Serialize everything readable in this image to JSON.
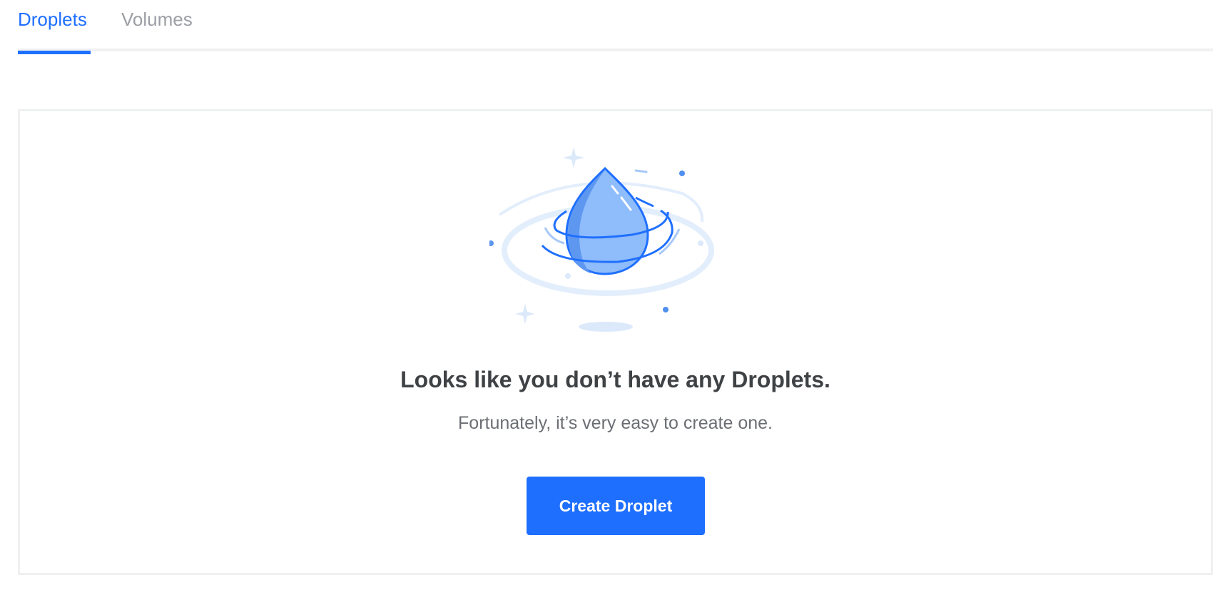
{
  "tabs": [
    {
      "label": "Droplets",
      "active": true
    },
    {
      "label": "Volumes",
      "active": false
    }
  ],
  "empty_state": {
    "illustration": "water-droplet-icon",
    "headline": "Looks like you don’t have any Droplets.",
    "subtext": "Fortunately, it’s very easy to create one.",
    "button_label": "Create Droplet"
  },
  "colors": {
    "accent": "#1f6fff",
    "inactive_tab": "#9b9ea3",
    "headline": "#3f4245",
    "subtext": "#6b6e73",
    "border": "#eff0f2"
  }
}
